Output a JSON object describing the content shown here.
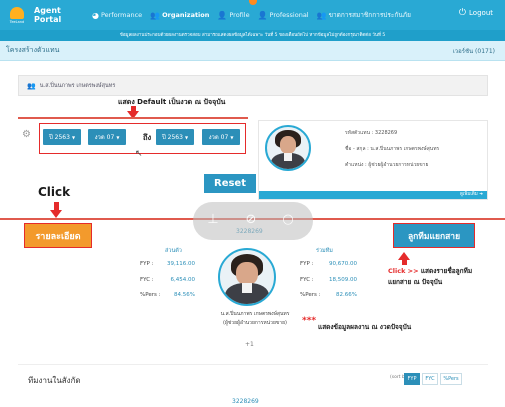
{
  "colors": {
    "nav_bg": "#29a9d4",
    "accent_blue": "#2b96c2",
    "orange": "#f39a2c",
    "annotation_red": "#e52b2b"
  },
  "nav": {
    "logo_text": "TeeLand",
    "brand": "Agent Portal",
    "items": [
      {
        "label": "Performance",
        "icon": "dashboard-icon"
      },
      {
        "label": "Organization",
        "icon": "users-icon",
        "active": true
      },
      {
        "label": "Profile",
        "icon": "user-icon"
      },
      {
        "label": "Professional",
        "icon": "user-tie-icon"
      },
      {
        "label": "ขาดการสมาชิกการประกันภัย",
        "icon": "users-group-icon"
      }
    ],
    "logout": "Logout"
  },
  "announcement": "ข้อมูลผลงานประกอบด้วยผลงานตรวจสอบ สามารถแสดงผลข้อมูลได้เฉพาะ วันที่ 5 ของเดือนถัดไป  หากข้อมูลไม่ถูกต้องกรุณาติดต่อ วันที่ 5",
  "page": {
    "title": "โครงสร้างตัวแทน",
    "version": "เวอร์ชัน (0171)"
  },
  "user_row": {
    "name": "น.ส.ปิ่นนภาพร  เกษตรพงษ์สุนทร"
  },
  "annotations": {
    "default_note": "แสดง Default เป็นงวด ณ ปัจจุบัน",
    "click_label": "Click",
    "click_note_prefix": "Click >>",
    "click_note_line1": "แสดงรายชื่อลูกทีม",
    "click_note_line2": "แยกสาย ณ ปัจจุบัน",
    "stars": "***",
    "perf_note": "แสดงข้อมูลผลงาน ณ งวดปัจจุบัน"
  },
  "filter": {
    "from_year": "ปี 2563",
    "from_period": "งวด 07",
    "to_label": "ถึง",
    "to_year": "ปี 2563",
    "to_period": "งวด 07",
    "reset_label": "Reset"
  },
  "profile": {
    "agent_code_label": "รหัสตัวแทน :",
    "agent_code": "3228269",
    "name_label": "ชื่อ - สกุล :",
    "name": "น.ส.ปิ่นนภาพร เกษตรพงษ์สุนทร",
    "position_label": "ตำแหน่ง :",
    "position": "ผู้ช่วยผู้อำนวยการหน่วยขาย",
    "more_link": "ดูเพิ่มเติม"
  },
  "actions": {
    "detail_button": "รายละเอียด",
    "team_button": "ลูกทีมแยกสาย",
    "agent_code": "3228269"
  },
  "stats": {
    "left_header": "ส่วนตัว",
    "right_header": "ร่วมทีม",
    "labels": [
      "FYP :",
      "FYC :",
      "%Pers :"
    ],
    "left_values": [
      "39,116.00",
      "6,454.00",
      "84.56%"
    ],
    "right_values": [
      "90,670.00",
      "18,509.00",
      "82.66%"
    ],
    "center_name": "น.ส.ปิ่นนภาพร เกษตรพงษ์สุนทร",
    "center_position": "(ผู้ช่วยผู้อำนวยการหน่วยขาย)",
    "plus": "+1"
  },
  "team": {
    "title": "ทีมงานในสังกัด",
    "sort_label": "(sort by)",
    "sort_options": [
      "FYP",
      "FYC",
      "%Pers"
    ],
    "bottom_code": "3228269"
  }
}
